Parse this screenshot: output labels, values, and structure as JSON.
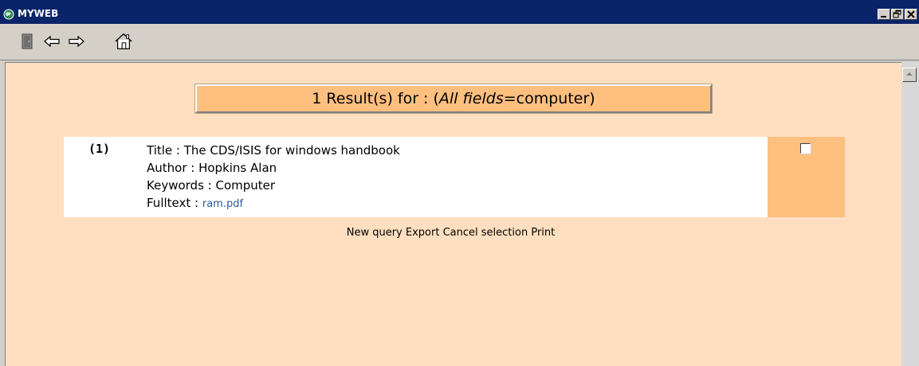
{
  "window": {
    "title": "MYWEB",
    "controls": [
      "_",
      "×",
      "×"
    ]
  },
  "toolbar": {
    "icons": [
      "exit-icon",
      "back-arrow-icon",
      "forward-arrow-icon",
      "home-icon"
    ]
  },
  "results": {
    "count_text": "1 Result(s) for : (",
    "field_label": "All fields",
    "query_text": "=computer)"
  },
  "record": {
    "number": "(1)",
    "title_line": "Title : The CDS/ISIS for windows handbook",
    "author_line": "Author : Hopkins Alan",
    "keywords_line": "Keywords : Computer",
    "fulltext_label": "Fulltext : ",
    "fulltext_link": "ram.pdf",
    "selected": false
  },
  "actions": {
    "new_query": "New query",
    "export": "Export",
    "cancel_selection": "Cancel selection",
    "print": "Print"
  },
  "colors": {
    "title_bar": "#0a246a",
    "content_bg": "#ffdfbf",
    "accent_orange": "#ffbf7f",
    "link": "#2a5a9a"
  }
}
